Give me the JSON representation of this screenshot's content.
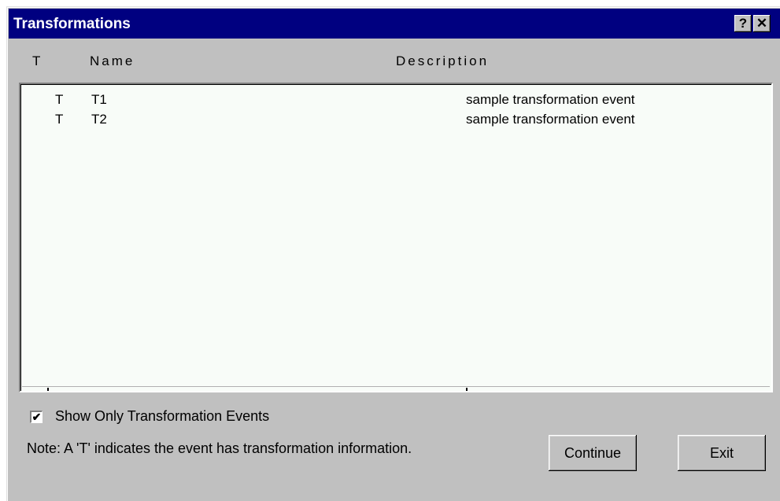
{
  "window": {
    "title": "Transformations",
    "help_label": "?",
    "close_label": "✕"
  },
  "columns": {
    "t": "T",
    "name": "Name",
    "description": "Description"
  },
  "rows": [
    {
      "t": "T",
      "name": "T1",
      "description": "sample transformation event"
    },
    {
      "t": "T",
      "name": "T2",
      "description": "sample transformation event"
    }
  ],
  "checkbox": {
    "label": "Show Only Transformation Events",
    "checked": true,
    "mark": "✔"
  },
  "note": "Note: A 'T' indicates the event has transformation information.",
  "buttons": {
    "continue": "Continue",
    "exit": "Exit"
  },
  "colors": {
    "titlebar": "#000080",
    "face": "#c0c0c0",
    "list_bg": "#f8fcf8"
  }
}
